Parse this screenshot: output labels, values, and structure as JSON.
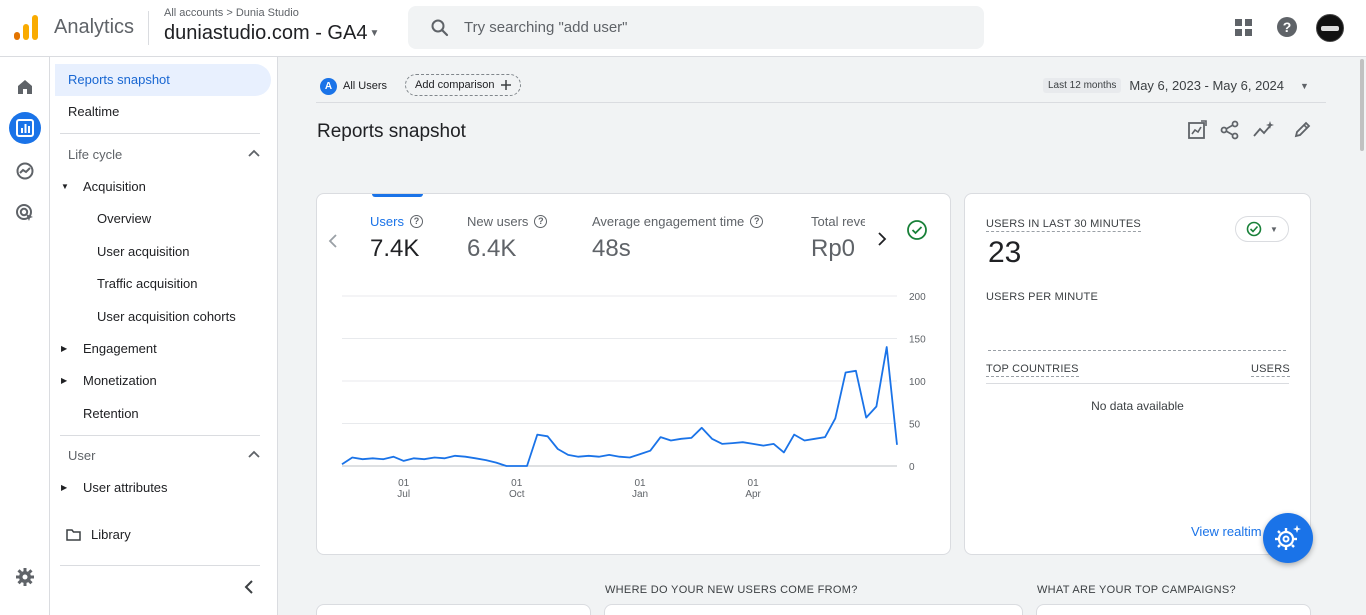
{
  "header": {
    "app_name": "Analytics",
    "breadcrumb": "All accounts > Dunia Studio",
    "property": "duniastudio.com - GA4",
    "search_placeholder": "Try searching \"add user\""
  },
  "sidenav": {
    "reports_snapshot": "Reports snapshot",
    "realtime": "Realtime",
    "lifecycle_section": "Life cycle",
    "acquisition": "Acquisition",
    "acquisition_items": [
      "Overview",
      "User acquisition",
      "Traffic acquisition",
      "User acquisition cohorts"
    ],
    "engagement": "Engagement",
    "monetization": "Monetization",
    "retention": "Retention",
    "user_section": "User",
    "user_attributes": "User attributes",
    "library": "Library"
  },
  "toolbar": {
    "segment_badge": "A",
    "segment_label": "All Users",
    "add_comparison": "Add comparison",
    "range_label": "Last 12 months",
    "date_range": "May 6, 2023 - May 6, 2024"
  },
  "page": {
    "title": "Reports snapshot"
  },
  "metrics": [
    {
      "label": "Users",
      "value": "7.4K"
    },
    {
      "label": "New users",
      "value": "6.4K"
    },
    {
      "label": "Average engagement time",
      "value": "48s"
    },
    {
      "label": "Total reve",
      "value": "Rp0"
    }
  ],
  "realtime": {
    "users_30_label": "USERS IN LAST 30 MINUTES",
    "users_30_value": "23",
    "per_minute_label": "USERS PER MINUTE",
    "top_countries_label": "TOP COUNTRIES",
    "users_col_label": "USERS",
    "no_data": "No data available",
    "view_link": "View realtim"
  },
  "bottom": {
    "new_users_heading": "WHERE DO YOUR NEW USERS COME FROM?",
    "campaigns_heading": "WHAT ARE YOUR TOP CAMPAIGNS?"
  },
  "colors": {
    "accent": "#1a73e8",
    "line": "#1a73e8",
    "success": "#188038"
  },
  "chart_data": {
    "type": "line",
    "title": "",
    "xlabel": "",
    "ylabel": "",
    "ylim": [
      0,
      200
    ],
    "y_ticks": [
      0,
      50,
      100,
      150,
      200
    ],
    "x_ticks": [
      {
        "day": "01",
        "month": "Jul"
      },
      {
        "day": "01",
        "month": "Oct"
      },
      {
        "day": "01",
        "month": "Jan"
      },
      {
        "day": "01",
        "month": "Apr"
      }
    ],
    "x_tick_index": [
      6,
      17,
      29,
      40
    ],
    "series": [
      {
        "values": [
          2,
          10,
          8,
          9,
          8,
          11,
          6,
          9,
          8,
          10,
          9,
          12,
          11,
          9,
          7,
          4,
          0,
          0,
          0,
          37,
          35,
          20,
          13,
          11,
          12,
          11,
          13,
          11,
          10,
          14,
          18,
          34,
          30,
          32,
          33,
          45,
          32,
          26,
          27,
          28,
          26,
          24,
          26,
          16,
          37,
          30,
          32,
          34,
          56,
          110,
          112,
          57,
          70,
          140,
          25
        ]
      }
    ]
  }
}
